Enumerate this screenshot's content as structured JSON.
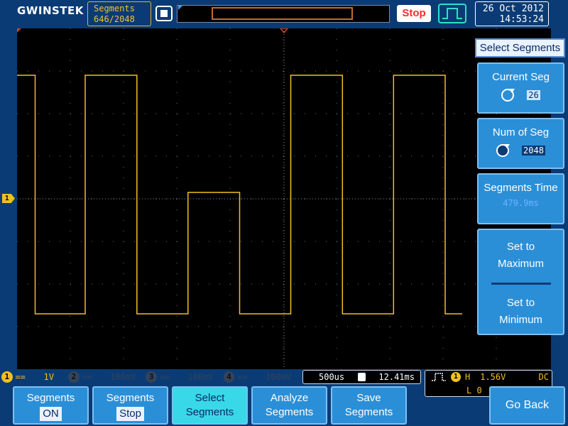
{
  "header": {
    "brand": "GWINSTEK",
    "segments_label": "Segments",
    "segments_count": "646/2048",
    "run_state": "Stop",
    "date": "26 Oct 2012",
    "time": "14:53:24"
  },
  "side_menu": {
    "title": "Select Segments",
    "current_seg": {
      "label": "Current Seg",
      "value": "26"
    },
    "num_of_seg": {
      "label": "Num of Seg",
      "value": "2048"
    },
    "segments_time": {
      "label": "Segments Time",
      "value": "479.9ms"
    },
    "set_max": {
      "line1": "Set to",
      "line2": "Maximum"
    },
    "set_min": {
      "line1": "Set to",
      "line2": "Minimum"
    }
  },
  "channels": [
    {
      "num": "1",
      "coupling": "==",
      "scale": "1V"
    },
    {
      "num": "2",
      "coupling": "==",
      "scale": "100mV"
    },
    {
      "num": "3",
      "coupling": "==",
      "scale": "100mV"
    },
    {
      "num": "4",
      "coupling": "==",
      "scale": "100mV"
    }
  ],
  "ch1_marker": "1",
  "timebase": {
    "scale": "500us",
    "delay": "12.41ms"
  },
  "trigger": {
    "channel": "1",
    "mode": "H",
    "level": "1.56V",
    "coupling": "DC",
    "row2": "L  0"
  },
  "bottom_menu": {
    "segments_on": {
      "label": "Segments",
      "option": "ON"
    },
    "segments_stop": {
      "label": "Segments",
      "option": "Stop"
    },
    "select_segments": {
      "line1": "Select",
      "line2": "Segments"
    },
    "analyze_segments": {
      "line1": "Analyze",
      "line2": "Segments"
    },
    "save_segments": {
      "line1": "Save",
      "line2": "Segments"
    },
    "go_back": "Go Back"
  },
  "colors": {
    "background": "#0b3b74",
    "trace_ch1": "#f0c020",
    "button": "#2b8fd8",
    "button_active": "#38d8e8"
  },
  "waveform": {
    "high_level_div": 2.9,
    "low_level_div": -2.7,
    "mid_level_div": 0.15,
    "segments": [
      {
        "from": 0.0,
        "to": 0.18,
        "level": "high"
      },
      {
        "from": 0.18,
        "to": 1.12,
        "level": "low"
      },
      {
        "from": 1.12,
        "to": 2.09,
        "level": "high"
      },
      {
        "from": 2.09,
        "to": 3.05,
        "level": "low"
      },
      {
        "from": 3.05,
        "to": 4.02,
        "level": "mid"
      },
      {
        "from": 4.02,
        "to": 4.98,
        "level": "low"
      },
      {
        "from": 4.98,
        "to": 5.95,
        "level": "high"
      },
      {
        "from": 5.95,
        "to": 6.91,
        "level": "low"
      },
      {
        "from": 6.91,
        "to": 7.88,
        "level": "high"
      },
      {
        "from": 7.88,
        "to": 8.2,
        "level": "low"
      }
    ]
  }
}
